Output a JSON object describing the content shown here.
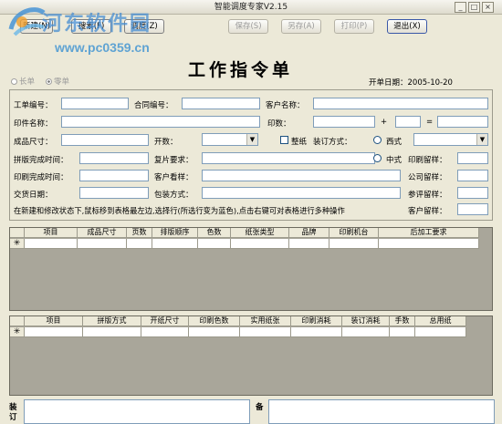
{
  "window": {
    "title": "智能调度专家V2.15",
    "controls": [
      "_",
      "□",
      "×"
    ]
  },
  "watermark": {
    "site_name": "河东软件园",
    "url": "www.pc0359.cn"
  },
  "toolbar": {
    "buttons": [
      {
        "label": "新建(N)"
      },
      {
        "label": "搜索(F)"
      },
      {
        "label": "调度(Z)"
      },
      {
        "label": "保存(S)"
      },
      {
        "label": "另存(A)"
      },
      {
        "label": "打印(P)"
      },
      {
        "label": "退出(X)"
      }
    ]
  },
  "document": {
    "title": "工作指令单",
    "order_date_label": "开单日期：",
    "order_date": "2005-10-20"
  },
  "order_type": {
    "options": [
      "长单",
      "零单"
    ],
    "selected": "零单"
  },
  "form": {
    "job_no": "工单编号：",
    "contract_no": "合同编号：",
    "customer_name": "客户名称：",
    "print_name": "印件名称：",
    "print_count": "印数：",
    "plus": "+",
    "equals": "=",
    "finished_size": "成品尺寸：",
    "format": "开数：",
    "whole_paper": "整纸",
    "binding_method": "装订方式：",
    "western": "西式",
    "chinese": "中式",
    "plate_done": "拼版完成时间：",
    "copy_request": "复片要求：",
    "print_retain": "印刷留样：",
    "print_done": "印刷完成时间：",
    "customer_review": "客户看样：",
    "company_retain": "公司留样：",
    "delivery_date": "交货日期：",
    "packaging": "包装方式：",
    "reference_retain": "参评留样：",
    "customer_retain": "客户留样：",
    "hint": "在新建和修改状态下,鼠标移到表格最左边,选择行(所选行变为蓝色),点击右键可对表格进行多种操作"
  },
  "table1": {
    "columns": [
      "项目",
      "成品尺寸",
      "页数",
      "排版顺序",
      "色数",
      "纸张类型",
      "品牌",
      "印刷机台",
      "后加工要求"
    ],
    "new_row_marker": "✳"
  },
  "table2": {
    "columns": [
      "项目",
      "拼版方式",
      "开纸尺寸",
      "印刷色数",
      "实用纸张",
      "印刷消耗",
      "装订消耗",
      "手数",
      "总用纸"
    ],
    "new_row_marker": "✳"
  },
  "bottom": {
    "left_label": "装订",
    "right_label": "备"
  },
  "colors": {
    "background": "#ece9d8",
    "grid_empty": "#a9a69a",
    "input_border": "#7f9db9",
    "watermark": "#468cd2"
  }
}
